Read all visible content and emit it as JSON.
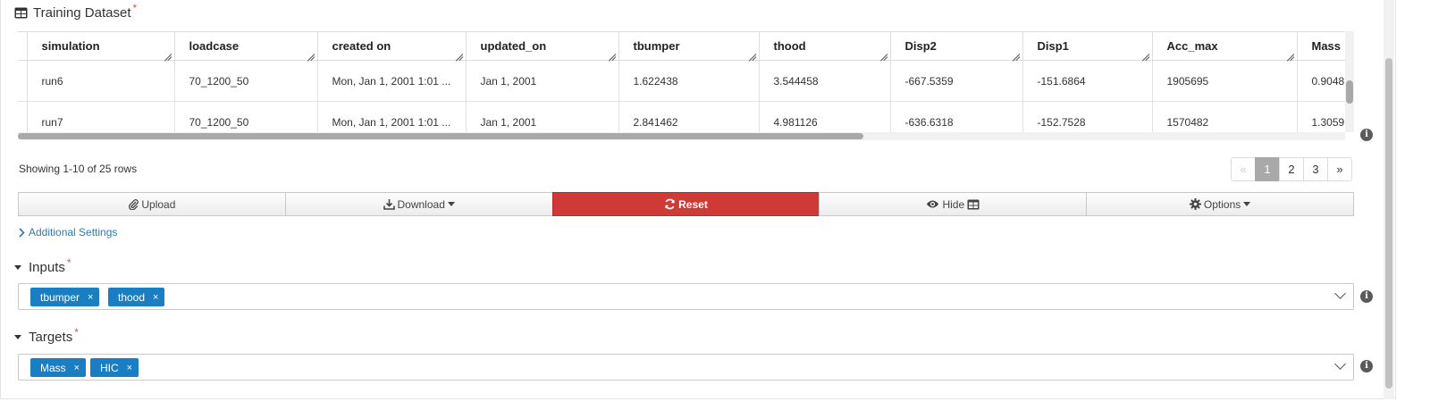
{
  "dataset": {
    "title": "Training Dataset",
    "required_mark": "*",
    "columns": [
      "simulation",
      "loadcase",
      "created on",
      "updated_on",
      "tbumper",
      "thood",
      "Disp2",
      "Disp1",
      "Acc_max",
      "Mass"
    ],
    "rows": [
      [
        "run6",
        "70_1200_50",
        "Mon, Jan 1, 2001 1:01 ...",
        "Jan 1, 2001",
        "1.622438",
        "3.544458",
        "-667.5359",
        "-151.6864",
        "1905695",
        "0.9048"
      ],
      [
        "run7",
        "70_1200_50",
        "Mon, Jan 1, 2001 1:01 ...",
        "Jan 1, 2001",
        "2.841462",
        "4.981126",
        "-636.6318",
        "-152.7528",
        "1570482",
        "1.3059"
      ]
    ],
    "rows_info": "Showing 1-10 of 25 rows",
    "pager": [
      "«",
      "1",
      "2",
      "3",
      "»"
    ],
    "active_page": "1"
  },
  "toolbar": {
    "upload": "Upload",
    "download": "Download",
    "reset": "Reset",
    "hide": "Hide",
    "options": "Options"
  },
  "additional_settings": "Additional Settings",
  "inputs": {
    "label": "Inputs",
    "required_mark": "*",
    "tags": [
      "tbumper",
      "thood"
    ]
  },
  "targets": {
    "label": "Targets",
    "required_mark": "*",
    "tags": [
      "Mass",
      "HIC"
    ]
  },
  "icons": {
    "table": "table-icon",
    "info": "info-icon",
    "remove": "×",
    "info_glyph": "i"
  },
  "colors": {
    "danger": "#cf3a36",
    "tag": "#1a7ec3",
    "link": "#2a7ab8",
    "required": "#d9534f"
  }
}
